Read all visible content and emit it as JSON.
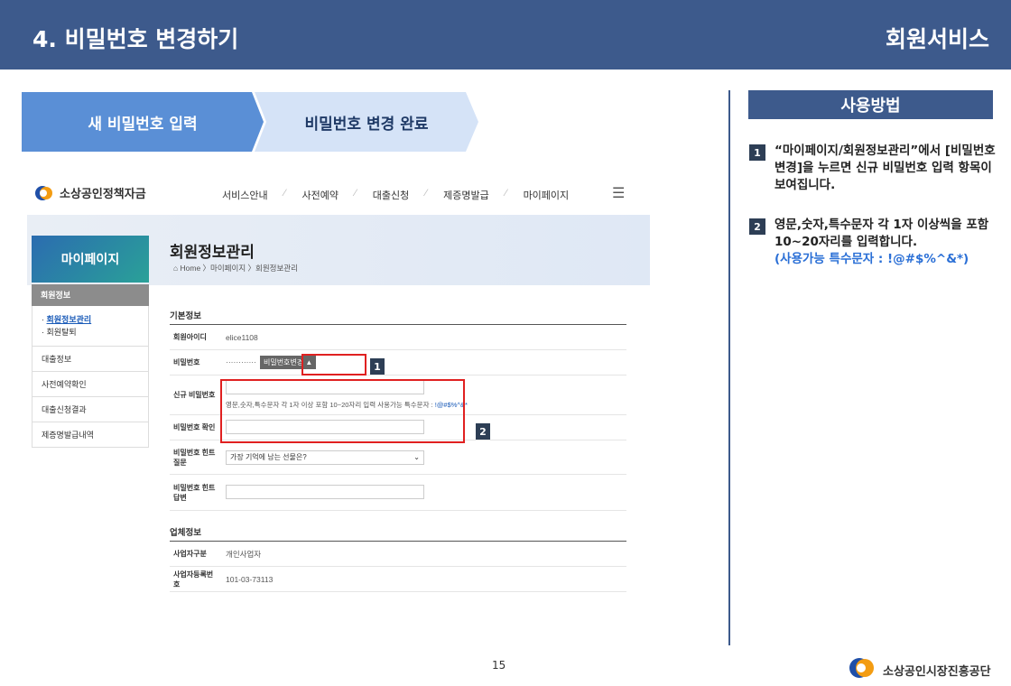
{
  "header": {
    "title": "4. 비밀번호 변경하기",
    "right": "회원서비스"
  },
  "steps": [
    {
      "label": "새 비밀번호 입력"
    },
    {
      "label": "비밀번호 변경 완료"
    }
  ],
  "site": {
    "logo": "소상공인정책자금",
    "nav": [
      "서비스안내",
      "사전예약",
      "대출신청",
      "제증명발급",
      "마이페이지"
    ],
    "sidebar": {
      "title": "마이페이지",
      "section": "회원정보",
      "links": [
        "회원정보관리",
        "회원탈퇴"
      ],
      "items": [
        "대출정보",
        "사전예약확인",
        "대출신청결과",
        "제증명발급내역"
      ]
    },
    "page_title": "회원정보관리",
    "breadcrumb": "Home 〉마이페이지 〉회원정보관리",
    "basic_section": "기본정보",
    "fields": {
      "id_label": "회원아이디",
      "id_value": "elice1108",
      "pw_label": "비밀번호",
      "pw_value": "············",
      "pw_button": "비밀번호변경 ▲",
      "new_pw_label": "신규 비밀번호",
      "hint_text": "영문,숫자,특수문자 각 1자 이상 포함 10~20자리 입력  사용가능 특수문자 : ",
      "hint_chars": "!@#$%^&*",
      "confirm_label": "비밀번호 확인",
      "q_label": "비밀번호 힌트 질문",
      "q_value": "가장 기억에 남는 선물은?",
      "a_label": "비밀번호 힌트 답변"
    },
    "biz_section": "업체정보",
    "biz": {
      "type_label": "사업자구분",
      "type_value": "개인사업자",
      "reg_label": "사업자등록번호",
      "reg_value": "101-03-73113"
    }
  },
  "markers": [
    "1",
    "2"
  ],
  "usage": {
    "title": "사용방법",
    "tips": [
      {
        "num": "1",
        "text": "“마이페이지/회원정보관리”에서 [비밀번호변경]을 누르면 신규 비밀번호 입력 항목이 보여집니다.",
        "note": ""
      },
      {
        "num": "2",
        "text": "영문,숫자,특수문자 각 1자 이상씩을 포함 10~20자리를 입력합니다.",
        "note": "(사용가능 특수문자 : !@#$%^&*)"
      }
    ]
  },
  "page_number": "15",
  "footer_logo": "소상공인시장진흥공단",
  "colors": {
    "header": "#3d5a8c",
    "step_active": "#5a8fd6",
    "step_inactive": "#d5e3f7",
    "highlight": "#e02020"
  }
}
